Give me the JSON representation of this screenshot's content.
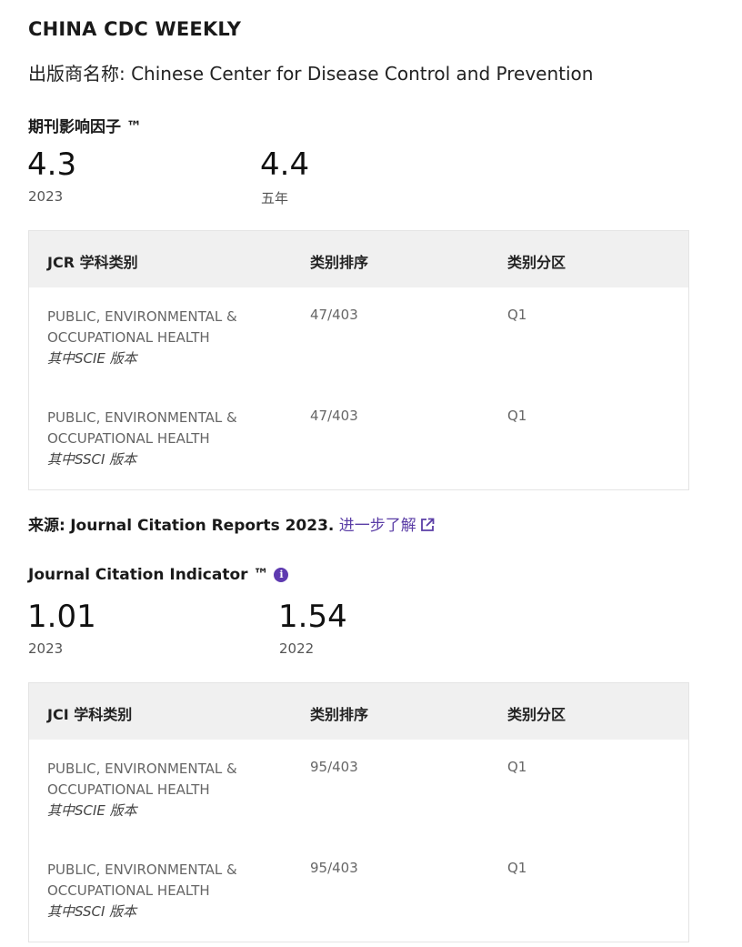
{
  "journal": {
    "title": "CHINA CDC WEEKLY",
    "publisher": "出版商名称: Chinese Center for Disease Control and Prevention"
  },
  "impact_factor": {
    "title": "期刊影响因子 ™",
    "metrics": [
      {
        "value": "4.3",
        "label": "2023"
      },
      {
        "value": "4.4",
        "label": "五年"
      }
    ]
  },
  "jcr_table": {
    "headers": [
      "JCR 学科类别",
      "类别排序",
      "类别分区"
    ],
    "rows": [
      {
        "category_line1": "PUBLIC, ENVIRONMENTAL &",
        "category_line2": "OCCUPATIONAL HEALTH",
        "edition": "其中SCIE 版本",
        "rank": "47/403",
        "quartile": "Q1"
      },
      {
        "category_line1": "PUBLIC, ENVIRONMENTAL &",
        "category_line2": "OCCUPATIONAL HEALTH",
        "edition": "其中SSCI 版本",
        "rank": "47/403",
        "quartile": "Q1"
      }
    ]
  },
  "source": {
    "label": "来源:",
    "text": "Journal Citation Reports  2023.",
    "link": "进一步了解",
    "link_icon": "external-link-icon"
  },
  "jci": {
    "title": "Journal Citation Indicator ™",
    "info_icon": "info-icon",
    "info_glyph": "i",
    "accent_color": "#5e3ab0",
    "metrics": [
      {
        "value": "1.01",
        "label": "2023"
      },
      {
        "value": "1.54",
        "label": "2022"
      }
    ]
  },
  "jci_table": {
    "headers": [
      "JCI 学科类别",
      "类别排序",
      "类别分区"
    ],
    "rows": [
      {
        "category_line1": "PUBLIC, ENVIRONMENTAL &",
        "category_line2": "OCCUPATIONAL HEALTH",
        "edition": "其中SCIE 版本",
        "rank": "95/403",
        "quartile": "Q1"
      },
      {
        "category_line1": "PUBLIC, ENVIRONMENTAL &",
        "category_line2": "OCCUPATIONAL HEALTH",
        "edition": "其中SSCI 版本",
        "rank": "95/403",
        "quartile": "Q1"
      }
    ]
  }
}
